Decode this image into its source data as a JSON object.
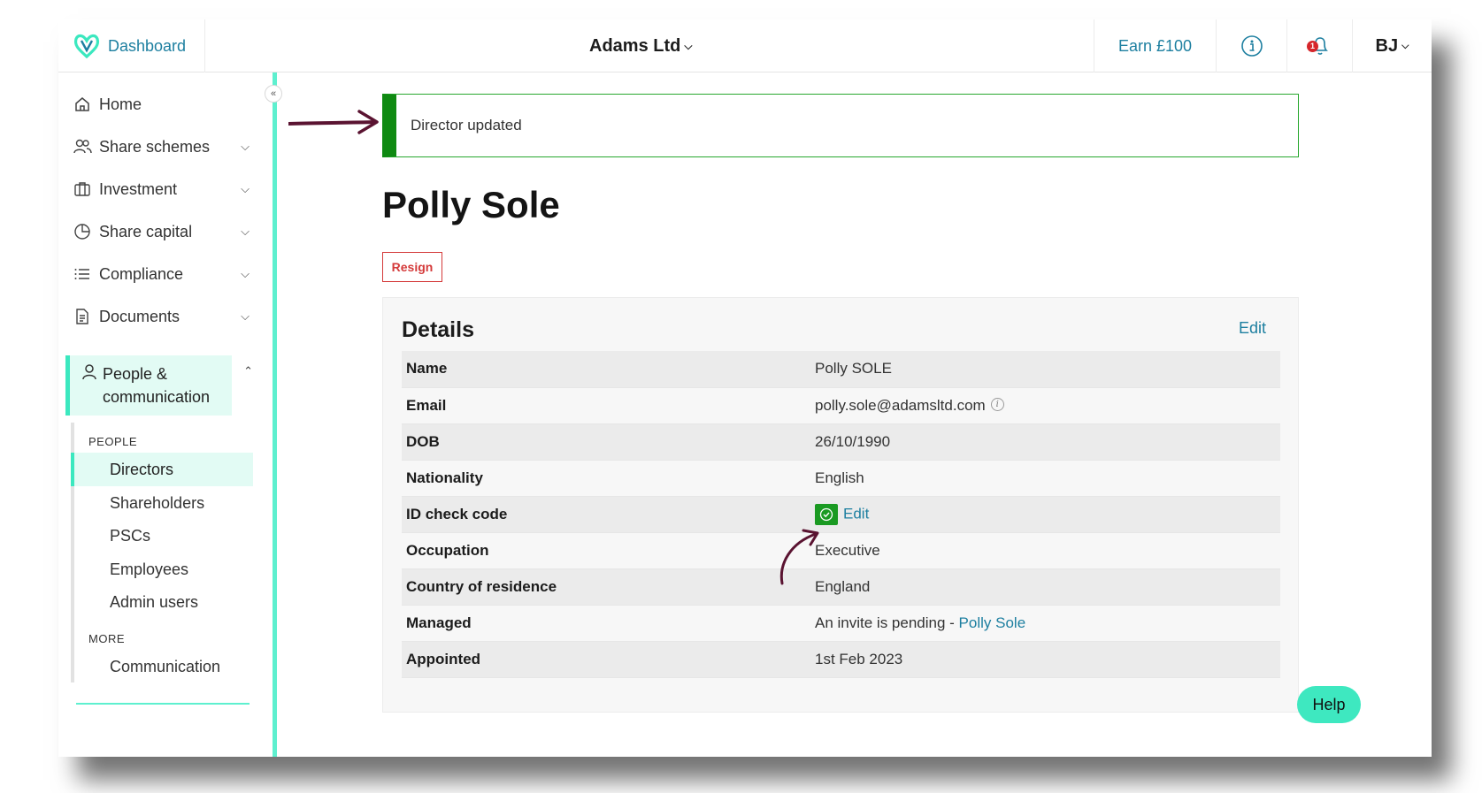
{
  "topbar": {
    "brand_label": "Dashboard",
    "company_name": "Adams Ltd",
    "earn_label": "Earn £100",
    "notification_count": "1",
    "user_initials": "BJ"
  },
  "sidebar": {
    "items": [
      {
        "label": "Home",
        "icon": "home-icon"
      },
      {
        "label": "Share schemes",
        "icon": "users-icon"
      },
      {
        "label": "Investment",
        "icon": "briefcase-icon"
      },
      {
        "label": "Share capital",
        "icon": "pie-chart-icon"
      },
      {
        "label": "Compliance",
        "icon": "list-icon"
      },
      {
        "label": "Documents",
        "icon": "document-icon"
      },
      {
        "label": "People & communication",
        "icon": "person-icon"
      }
    ],
    "people_header": "PEOPLE",
    "people_items": [
      "Directors",
      "Shareholders",
      "PSCs",
      "Employees",
      "Admin users"
    ],
    "more_header": "MORE",
    "more_items": [
      "Communication"
    ]
  },
  "main": {
    "banner": "Director updated",
    "title": "Polly Sole",
    "resign_label": "Resign",
    "details": {
      "title": "Details",
      "edit_label": "Edit",
      "rows": [
        {
          "key": "Name",
          "value": "Polly SOLE"
        },
        {
          "key": "Email",
          "value": "polly.sole@adamsltd.com"
        },
        {
          "key": "DOB",
          "value": "26/10/1990"
        },
        {
          "key": "Nationality",
          "value": "English"
        },
        {
          "key": "ID check code",
          "value": "Edit"
        },
        {
          "key": "Occupation",
          "value": "Executive"
        },
        {
          "key": "Country of residence",
          "value": "England"
        },
        {
          "key": "Managed",
          "value": "An invite is pending - ",
          "link": "Polly Sole"
        },
        {
          "key": "Appointed",
          "value": "1st Feb 2023"
        }
      ]
    }
  },
  "help_label": "Help",
  "colors": {
    "brand": "#1d7fa0",
    "accent": "#3be8bf",
    "success": "#0f8a12",
    "danger": "#d43a3a"
  }
}
